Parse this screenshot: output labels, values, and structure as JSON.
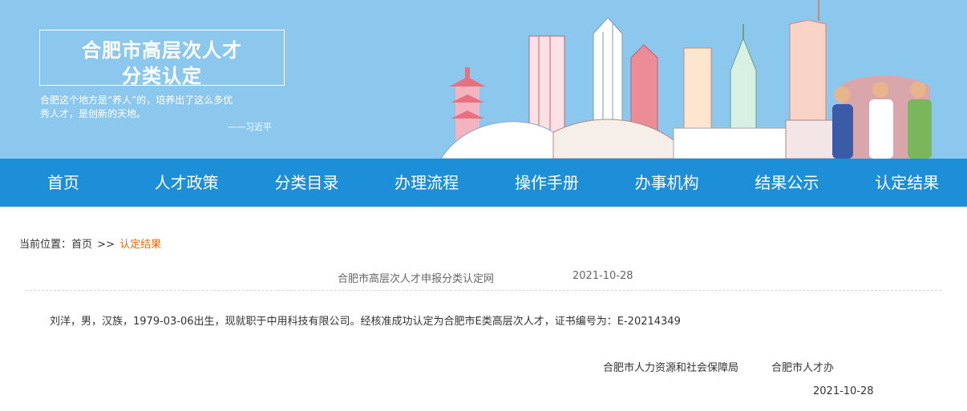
{
  "banner": {
    "title_line1": "合肥市高层次人才",
    "title_line2": "分类认定",
    "quote_line1": "合肥这个地方是“养人”的，培养出了这么多优",
    "quote_line2": "秀人才，是创新的天地。",
    "quote_author": "——习近平"
  },
  "nav": {
    "items": [
      "首页",
      "人才政策",
      "分类目录",
      "办理流程",
      "操作手册",
      "办事机构",
      "结果公示",
      "认定结果"
    ]
  },
  "breadcrumb": {
    "prefix": "当前位置：",
    "home": "首页",
    "separator": ">>",
    "current": "认定结果"
  },
  "article": {
    "source": "合肥市高层次人才申报分类认定网",
    "date": "2021-10-28",
    "content": "刘洋，男，汉族，1979-03-06出生，现就职于中用科技有限公司。经核准成功认定为合肥市E类高层次人才，证书编号为：E-20214349",
    "signatory1": "合肥市人力资源和社会保障局",
    "signatory2": "合肥市人才办",
    "signed_date": "2021-10-28"
  },
  "colors": {
    "banner_bg": "#8cc8ee",
    "nav_bg": "#1d8ed8",
    "breadcrumb_current": "#e06c14"
  }
}
